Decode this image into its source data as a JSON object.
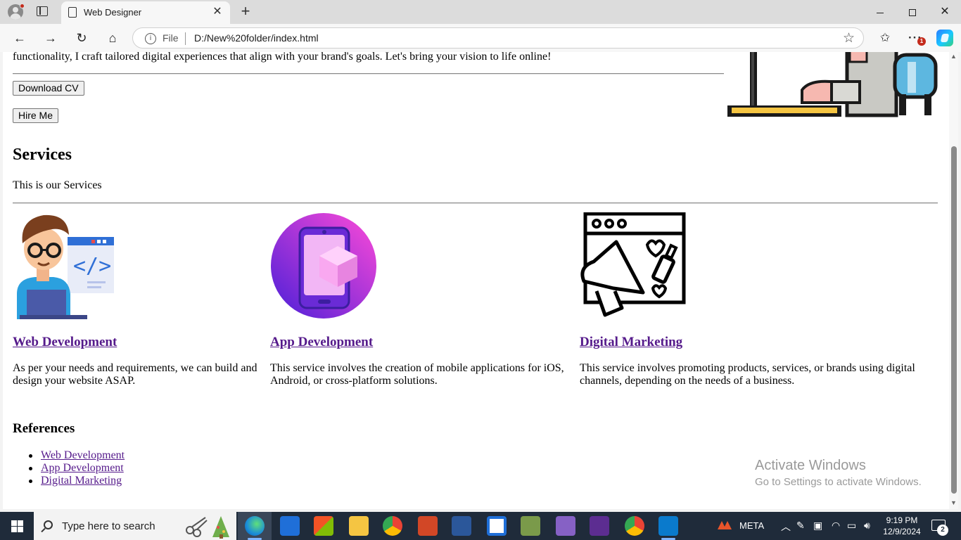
{
  "browser": {
    "tab_title": "Web Designer",
    "address": {
      "scheme_label": "File",
      "url": "D:/New%20folder/index.html"
    },
    "toolbar_icons": [
      "back-icon",
      "forward-icon",
      "refresh-icon",
      "home-icon",
      "info-icon",
      "favorite-star-icon",
      "favorites-icon",
      "more-icon",
      "copilot-icon"
    ],
    "more_badge": "1"
  },
  "page": {
    "intro_text": "functionality, I craft tailored digital experiences that align with your brand's goals. Let's bring your vision to life online!",
    "buttons": {
      "download_cv": "Download CV",
      "hire_me": "Hire Me"
    },
    "services": {
      "heading": "Services",
      "subheading": "This is our Services",
      "items": [
        {
          "title": "Web Development",
          "description": "As per your needs and requirements, we can build and design your website ASAP."
        },
        {
          "title": "App Development",
          "description": "This service involves the creation of mobile applications for iOS, Android, or cross-platform solutions."
        },
        {
          "title": "Digital Marketing",
          "description": "This service involves promoting products, services, or brands using digital channels, depending on the needs of a business."
        }
      ]
    },
    "references": {
      "heading": "References",
      "links": [
        "Web Development",
        "App Development",
        "Digital Marketing"
      ]
    }
  },
  "watermark": {
    "title": "Activate Windows",
    "subtitle": "Go to Settings to activate Windows."
  },
  "taskbar": {
    "search_placeholder": "Type here to search",
    "apps": [
      "edge",
      "mail",
      "microsoft-store",
      "file-explorer",
      "chrome",
      "powerpoint",
      "word",
      "news",
      "minecraft",
      "visual-studio",
      "visual-studio-preview",
      "chrome-profile",
      "vscode"
    ],
    "tray_label": "META",
    "time": "9:19 PM",
    "date": "12/9/2024",
    "notification_count": "2"
  },
  "colors": {
    "link_visited": "#551a8b",
    "taskbar": "#1f2b3a",
    "tabbar": "#dcdcdc"
  }
}
